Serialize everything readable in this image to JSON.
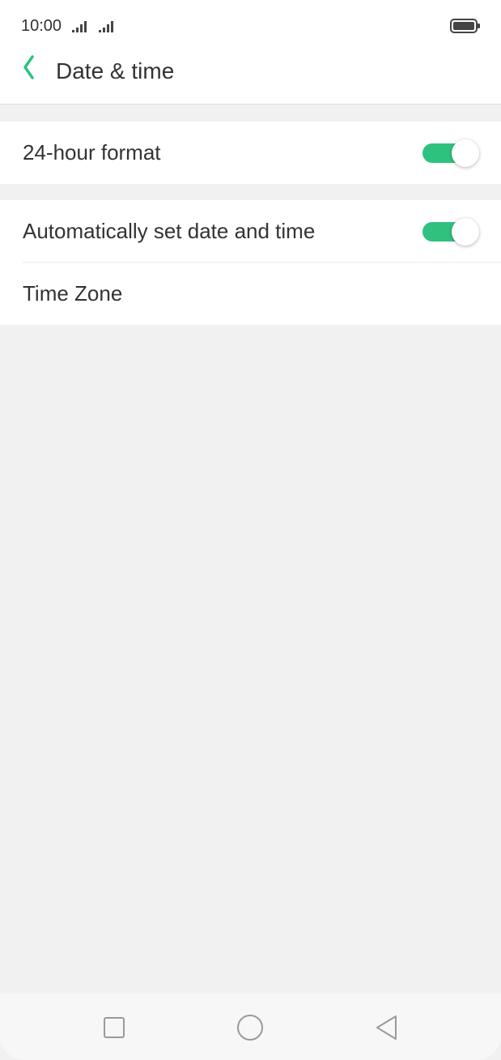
{
  "status_bar": {
    "time": "10:00",
    "icons": [
      "signal-icon",
      "signal-icon",
      "battery-icon"
    ]
  },
  "header": {
    "title": "Date & time",
    "back_icon": "chevron-left-icon"
  },
  "settings": {
    "format_group": {
      "items": [
        {
          "label": "24-hour format",
          "toggle_on": true
        }
      ]
    },
    "auto_group": {
      "items": [
        {
          "label": "Automatically set date and time",
          "toggle_on": true
        },
        {
          "label": "Time Zone"
        }
      ]
    }
  },
  "nav_bar": {
    "icons": [
      "square-icon",
      "circle-icon",
      "triangle-back-icon"
    ]
  },
  "colors": {
    "accent": "#2ec27e",
    "background": "#f1f1f1",
    "surface": "#ffffff",
    "text": "#333333"
  }
}
